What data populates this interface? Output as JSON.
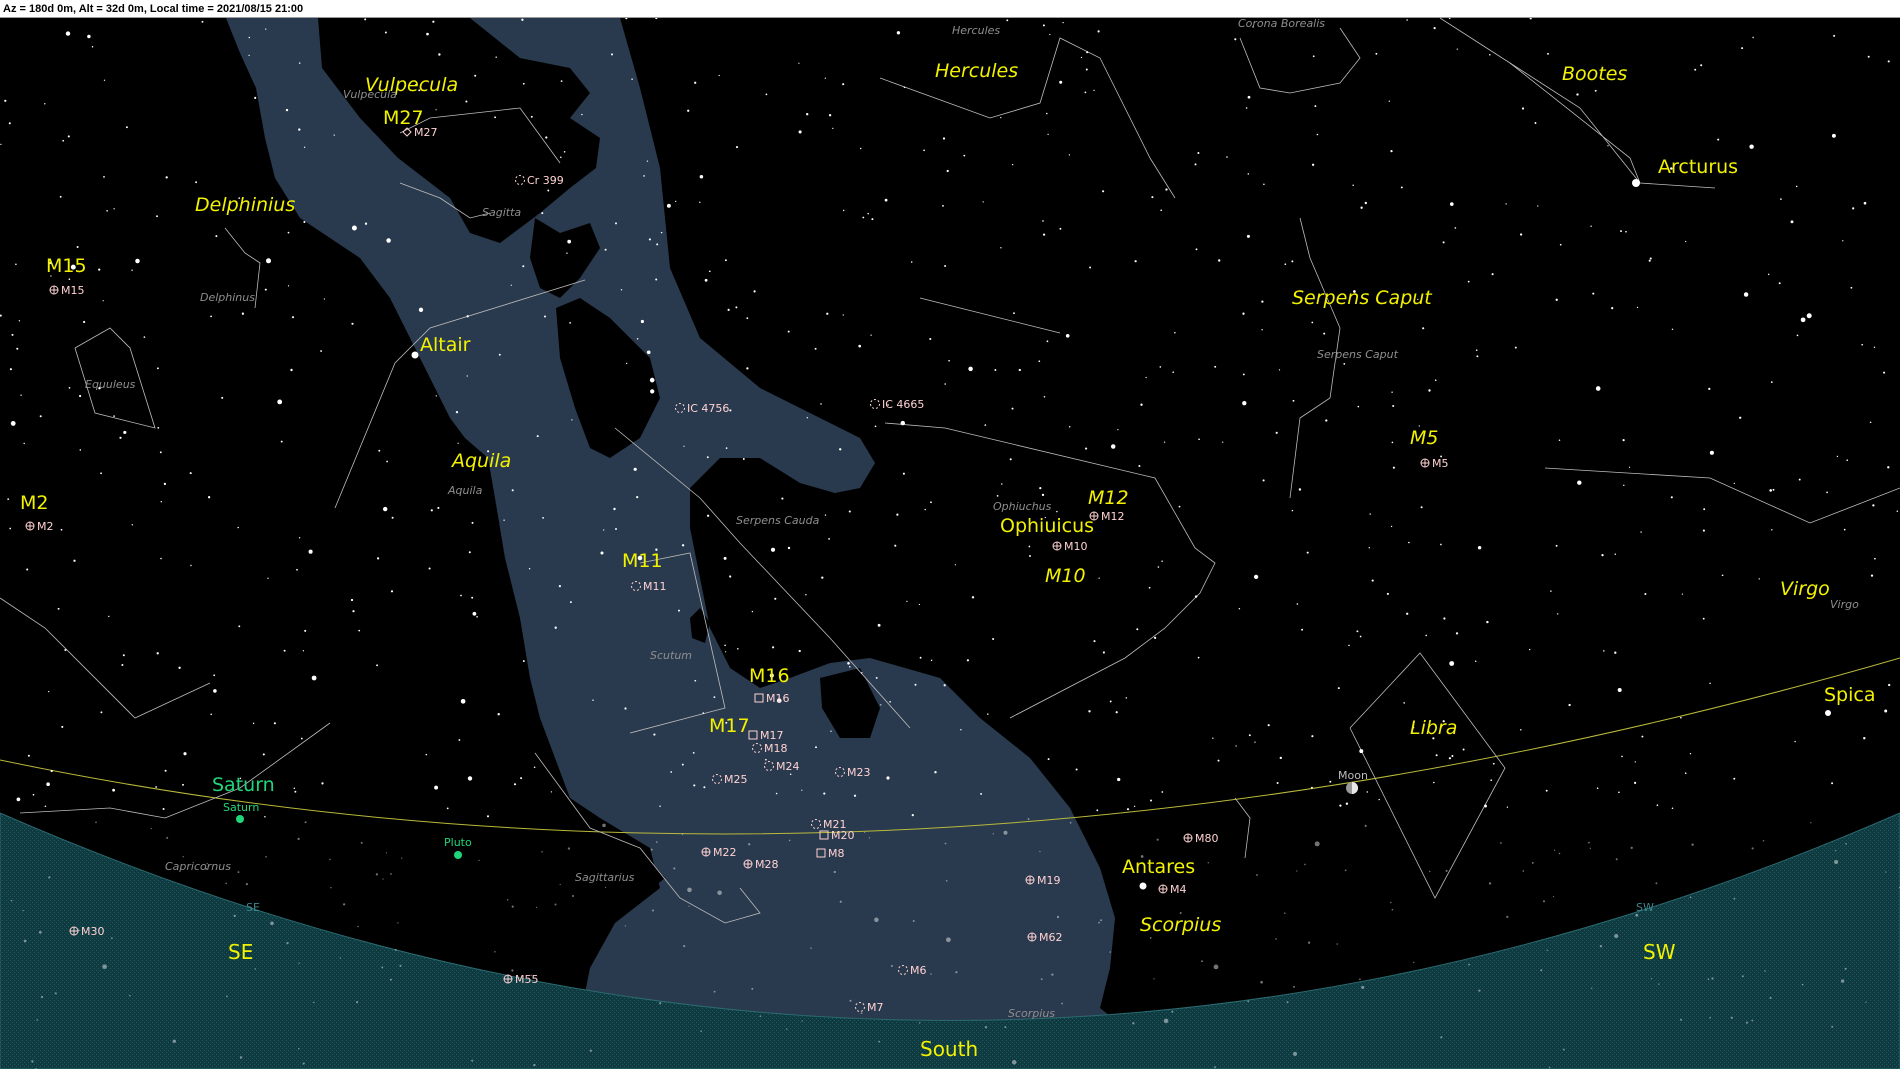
{
  "status": "Az = 180d 0m, Alt = 32d 0m, Local time = 2021/08/15 21:00",
  "colors": {
    "sky": "#000000",
    "milky_way": "#2a3a4e",
    "horizon": "#103c42",
    "constellation_line": "#c8c8c8",
    "constellation_name": "#f2f200",
    "faint_name": "#8e8e8e",
    "object_label": "#ffd2d2",
    "planet": "#1fd77a",
    "star_name": "#f2f200",
    "ecliptic": "#b9b93a"
  },
  "constellations": {
    "hercules": "Hercules",
    "hercules_small": "Hercules",
    "corona_borealis": "Corona Borealis",
    "bootes": "Bootes",
    "vulpecula": "Vulpecula",
    "vulpecula_small": "Vulpecula",
    "delphinius": "Delphinius",
    "delphinus_small": "Delphinus",
    "sagitta": "Sagitta",
    "equuleus": "Equuleus",
    "aquila": "Aquila",
    "aquila_small": "Aquila",
    "serpens_caput": "Serpens Caput",
    "serpens_caput_small": "Serpens Caput",
    "serpens_cauda": "Serpens Cauda",
    "ophiuchus_small": "Ophiuchus",
    "ophiuicus": "Ophiuicus",
    "scutum": "Scutum",
    "virgo": "Virgo",
    "virgo_small": "Virgo",
    "libra": "Libra",
    "scorpius": "Scorpius",
    "scorpius_small": "Scorpius",
    "sagittarius": "Sagittarius",
    "capricornus": "Capricornus"
  },
  "stars": {
    "arcturus": "Arcturus",
    "altair": "Altair",
    "spica": "Spica",
    "antares": "Antares"
  },
  "planets": {
    "saturn": "Saturn",
    "saturn_small": "Saturn",
    "pluto": "Pluto",
    "moon": "Moon"
  },
  "directions": {
    "se": "SE",
    "se_small": "SE",
    "south": "South",
    "sw": "SW",
    "sw_small": "SW"
  },
  "objects_big": {
    "m15": "M15",
    "m27": "M27",
    "m2": "M2",
    "m11": "M11",
    "m16": "M16",
    "m17": "M17",
    "m5": "M5",
    "m12": "M12",
    "m10": "M10"
  },
  "objects": {
    "m15": "M15",
    "m27": "M27",
    "cr399": "Cr 399",
    "m2": "M2",
    "ic4756": "IC 4756",
    "ic4665": "IC 4665",
    "m5": "M5",
    "m12": "M12",
    "m10": "M10",
    "m11": "M11",
    "m16": "M16",
    "m17": "M17",
    "m18": "M18",
    "m24": "M24",
    "m23": "M23",
    "m25": "M25",
    "m21": "M21",
    "m20": "M20",
    "m8": "M8",
    "m22": "M22",
    "m28": "M28",
    "m19": "M19",
    "m80": "M80",
    "m4": "M4",
    "m62": "M62",
    "m6": "M6",
    "m7": "M7",
    "m30": "M30",
    "m55": "M55"
  }
}
